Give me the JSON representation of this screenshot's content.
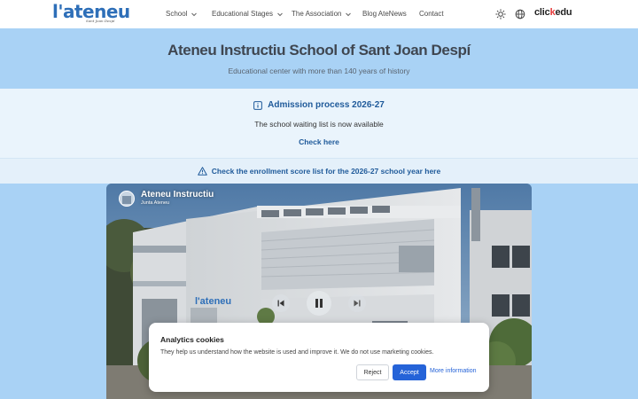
{
  "header": {
    "logo_text": "l'ateneu",
    "logo_sub": "Sant Joan Despí",
    "nav": [
      {
        "label": "School"
      },
      {
        "label": "Educational Stages"
      },
      {
        "label": "The Association"
      },
      {
        "label": "Blog AteNews"
      },
      {
        "label": "Contact"
      }
    ],
    "icons": [
      "sun-icon",
      "globe-icon"
    ],
    "clickedu_pre": "clic",
    "clickedu_k": "k",
    "clickedu_post": "edu"
  },
  "hero": {
    "title": "Ateneu Instructiu School of Sant Joan Despí",
    "subtitle": "Educational center with more than 140 years of history"
  },
  "admission": {
    "title": "Admission process 2026-27",
    "text": "The school waiting list is now available",
    "link": "Check here"
  },
  "notice": {
    "text": "Check the enrollment score list for the 2026-27 school year here"
  },
  "video": {
    "channel_title": "Ateneu Instructiu",
    "channel_sub": "Junta Ateneu",
    "building_sign": "l'ateneu",
    "controls": [
      "previous-icon",
      "pause-icon",
      "next-icon"
    ]
  },
  "cookie": {
    "title": "Analytics cookies",
    "text": "They help us understand how the website is used and improve it. We do not use marketing cookies.",
    "reject": "Reject",
    "accept": "Accept",
    "more": "More information"
  },
  "colors": {
    "brand_blue": "#2e6fb8",
    "link_blue": "#1f5a9a",
    "hero_bg": "#a9d2f5",
    "accept_bg": "#2563d8",
    "clickedu_accent": "#e63b3b"
  }
}
